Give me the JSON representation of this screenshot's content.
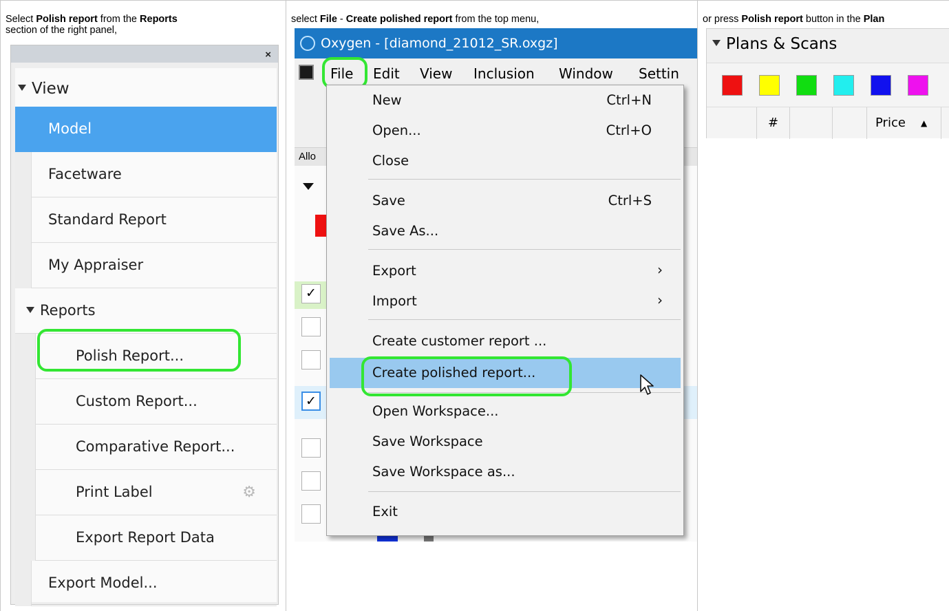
{
  "captions": {
    "col1": [
      {
        "text": "Select ",
        "bold": false
      },
      {
        "text": "Polish report",
        "bold": true
      },
      {
        "text": " from the ",
        "bold": false
      },
      {
        "text": "Reports",
        "bold": true
      },
      {
        "text": "section of the right panel,",
        "bold": false
      }
    ],
    "col2": [
      {
        "text": "select ",
        "bold": false
      },
      {
        "text": "File",
        "bold": true
      },
      {
        "text": " - ",
        "bold": false
      },
      {
        "text": "Create polished report",
        "bold": true
      },
      {
        "text": " from the top menu,",
        "bold": false
      }
    ],
    "col3": [
      {
        "text": "or press ",
        "bold": false
      },
      {
        "text": "Polish report",
        "bold": true
      },
      {
        "text": " button in the ",
        "bold": false
      },
      {
        "text": "Plan",
        "bold": true
      }
    ]
  },
  "panel": {
    "close_label": "×",
    "view_header": "View",
    "model": "Model",
    "facetware": "Facetware",
    "standard_report": "Standard Report",
    "my_appraiser": "My Appraiser",
    "reports_header": "Reports",
    "polish_report": "Polish Report...",
    "custom_report": "Custom Report...",
    "comparative_report": "Comparative Report...",
    "print_label": "Print Label",
    "export_report_data": "Export Report Data",
    "export_model": "Export Model..."
  },
  "app": {
    "window_title": "Oxygen - [diamond_21012_SR.oxgz]",
    "menubar": [
      "File",
      "Edit",
      "View",
      "Inclusion",
      "Window",
      "Settin"
    ],
    "allo_label": "Allo",
    "file_menu": [
      {
        "label": "New",
        "shortcut": "Ctrl+N"
      },
      {
        "label": "Open...",
        "shortcut": "Ctrl+O"
      },
      {
        "label": "Close",
        "shortcut": ""
      },
      {
        "label": "Save",
        "shortcut": "Ctrl+S"
      },
      {
        "label": "Save As...",
        "shortcut": ""
      },
      {
        "label": "Export",
        "shortcut": ""
      },
      {
        "label": "Import",
        "shortcut": ""
      },
      {
        "label": "Create customer report ...",
        "shortcut": ""
      },
      {
        "label": "Create polished report...",
        "shortcut": ""
      },
      {
        "label": "Open Workspace...",
        "shortcut": ""
      },
      {
        "label": "Save Workspace",
        "shortcut": ""
      },
      {
        "label": "Save Workspace as...",
        "shortcut": ""
      },
      {
        "label": "Exit",
        "shortcut": ""
      }
    ],
    "checkmark": "✓",
    "submenu_arrow": "›"
  },
  "plans": {
    "header": "Plans & Scans",
    "swatches": [
      "#ee1111",
      "#ffff00",
      "#11dd11",
      "#22eeee",
      "#1111ee",
      "#ee11ee"
    ],
    "col_hash": "#",
    "col_price": "Price"
  },
  "colors": {
    "highlight": "#33e633",
    "selection": "#4aa3ee",
    "menu_active": "#99c9ef",
    "titlebar": "#1c78c5"
  }
}
